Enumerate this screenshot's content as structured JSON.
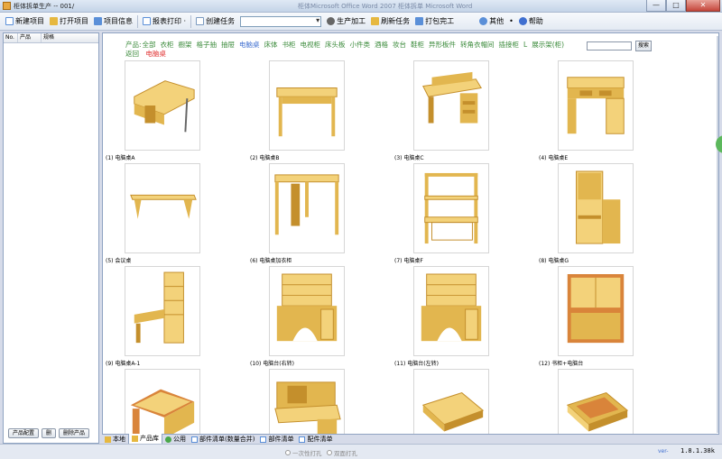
{
  "window": {
    "title": "柜体拆单生产 -- 001/",
    "ghost_text": "柜体Microsoft Office Word 2007 柜体拆单 Microsoft Word",
    "buttons": [
      "—",
      "□",
      "✕"
    ]
  },
  "toolbar": {
    "items": [
      {
        "label": "新建项目",
        "icon": "new-doc-icon",
        "color": "#5a8fd8"
      },
      {
        "label": "打开项目",
        "icon": "open-folder-icon",
        "color": "#e6b840"
      },
      {
        "label": "项目信息",
        "icon": "info-icon",
        "color": "#5a8fd8"
      },
      {
        "label": "报表打印 ·",
        "icon": "report-icon",
        "color": "#5a8fd8"
      },
      {
        "label": "创建任务",
        "icon": "task-icon",
        "color": "#7a9ac0"
      },
      {
        "label": "生产加工",
        "icon": "gear-icon",
        "color": "#666666"
      },
      {
        "label": "刷新任务",
        "icon": "refresh-icon",
        "color": "#e6b840"
      },
      {
        "label": "打包完工",
        "icon": "package-icon",
        "color": "#5a8fd8"
      },
      {
        "label": "其他",
        "icon": "other-icon",
        "color": "#5a8fd8"
      },
      {
        "label": "帮助",
        "icon": "help-icon",
        "color": "#3f6fd0"
      }
    ],
    "dot": "•",
    "combo_value": ""
  },
  "left_panel": {
    "columns": [
      "No.",
      "产品",
      "规格"
    ],
    "buttons": [
      "产品配置",
      "删",
      "删除产品"
    ]
  },
  "categories": {
    "label": "产品:",
    "items": [
      "全部",
      "衣柜",
      "橱架",
      "格子抽",
      "抽屉",
      "电脑桌",
      "床体",
      "书柜",
      "电视柜",
      "床头板",
      "小件类",
      "酒格",
      "妆台",
      "鞋柜",
      "异形板件",
      "转角衣帽间",
      "插接柜",
      "L",
      "展示架(柜)"
    ],
    "active_index": 5,
    "search_button": "搜索",
    "back": "返回",
    "current": "电脑桌"
  },
  "products": [
    {
      "caption": "(1) 电脑桌A",
      "shape": "desk-corner"
    },
    {
      "caption": "(2) 电脑桌B",
      "shape": "desk-simple"
    },
    {
      "caption": "(3) 电脑桌C",
      "shape": "desk-hutch-low"
    },
    {
      "caption": "(4) 电脑桌E",
      "shape": "desk-drawers"
    },
    {
      "caption": "(5) 会议桌",
      "shape": "table-long"
    },
    {
      "caption": "(6) 电脑桌加衣柜",
      "shape": "frame-tall"
    },
    {
      "caption": "(7) 电脑桌F",
      "shape": "frame-open"
    },
    {
      "caption": "(8) 电脑桌G",
      "shape": "tall-cabinet"
    },
    {
      "caption": "(9) 电脑桌A-1",
      "shape": "desk-shelves"
    },
    {
      "caption": "(10) 电脑台(右转)",
      "shape": "desk-arch"
    },
    {
      "caption": "(11) 电脑台(左转)",
      "shape": "desk-arch"
    },
    {
      "caption": "(12) 书柜+电脑台",
      "shape": "bunk"
    },
    {
      "caption": "",
      "shape": "l-desk"
    },
    {
      "caption": "",
      "shape": "desk-hutch-tall"
    },
    {
      "caption": "",
      "shape": "box-flat"
    },
    {
      "caption": "",
      "shape": "box-flat-orange"
    }
  ],
  "tabs": [
    {
      "label": "本地",
      "icon": "folder-icon",
      "active": false
    },
    {
      "label": "产品库",
      "icon": "library-icon",
      "active": true
    },
    {
      "label": "公用",
      "icon": "globe-icon",
      "active": false
    },
    {
      "label": "部件清单(数量合并)",
      "icon": "list-icon",
      "active": false
    },
    {
      "label": "部件清单",
      "icon": "list-icon",
      "active": false
    },
    {
      "label": "配件清单",
      "icon": "parts-icon",
      "active": false
    }
  ],
  "status": {
    "radio1": "一次性打孔",
    "radio2": "双面打孔",
    "user": "ver-",
    "version": "1.8.1.38k"
  },
  "colors": {
    "wood_light": "#f3d27a",
    "wood_mid": "#e2b64f",
    "wood_dark": "#c48f2c",
    "wood_orange": "#d9843a"
  }
}
